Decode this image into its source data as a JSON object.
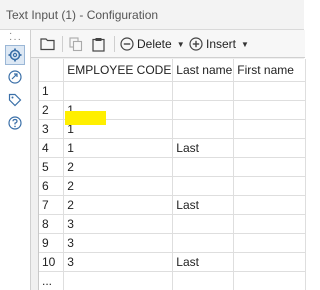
{
  "title": "Text Input (1) - Configuration",
  "toolbar": {
    "delete_label": "Delete",
    "insert_label": "Insert"
  },
  "sidebar": {
    "items": [
      {
        "icon": "gear-icon"
      },
      {
        "icon": "connection-icon"
      },
      {
        "icon": "tag-icon"
      },
      {
        "icon": "help-icon"
      }
    ]
  },
  "grid": {
    "columns": [
      "",
      "EMPLOYEE CODE",
      "Last name",
      "First name"
    ],
    "rows": [
      [
        "1",
        "",
        "",
        ""
      ],
      [
        "2",
        "1",
        "",
        ""
      ],
      [
        "3",
        "1",
        "",
        ""
      ],
      [
        "4",
        "1",
        "Last",
        ""
      ],
      [
        "5",
        "2",
        "",
        ""
      ],
      [
        "6",
        "2",
        "",
        ""
      ],
      [
        "7",
        "2",
        "Last",
        ""
      ],
      [
        "8",
        "3",
        "",
        ""
      ],
      [
        "9",
        "3",
        "",
        ""
      ],
      [
        "10",
        "3",
        "Last",
        ""
      ],
      [
        "...",
        "",
        "",
        ""
      ]
    ],
    "selected_cell_color": "#ffef00"
  }
}
